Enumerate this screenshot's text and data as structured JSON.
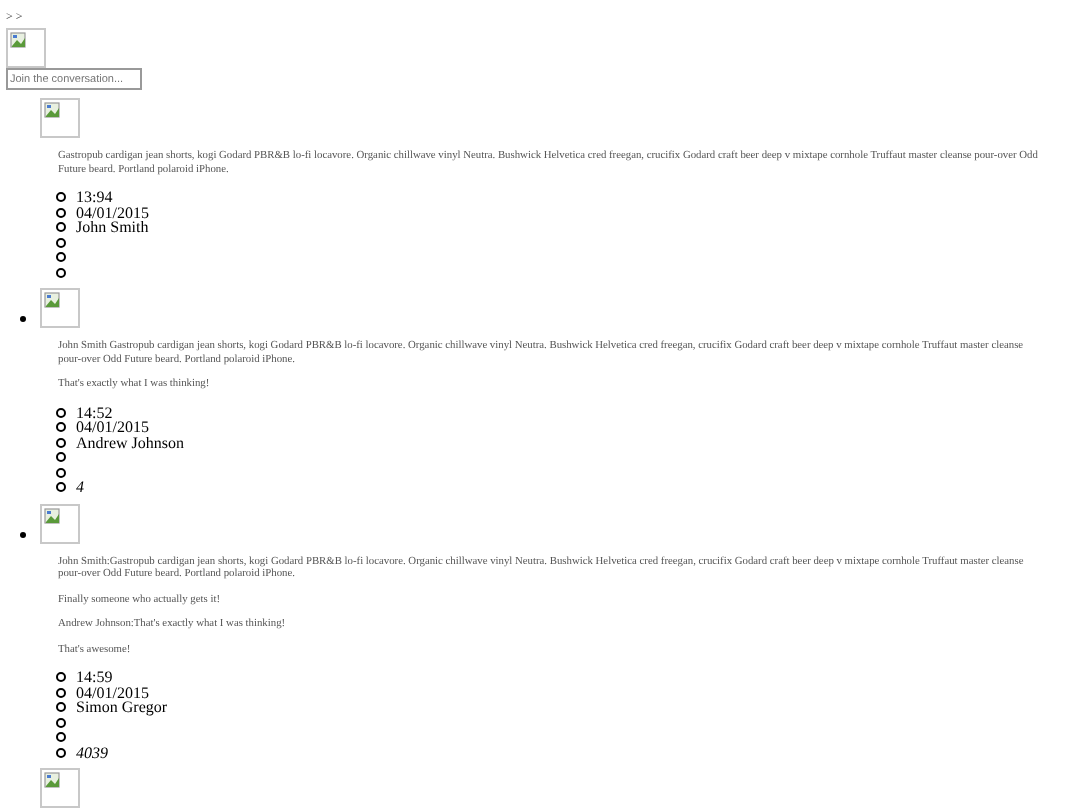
{
  "breadcrumb": "> >",
  "search": {
    "placeholder": "Join the conversation..."
  },
  "comments": [
    {
      "bulleted": false,
      "paragraphs": [
        "Gastropub cardigan jean shorts, kogi Godard PBR&B lo-fi locavore. Organic chillwave vinyl Neutra. Bushwick Helvetica cred freegan, crucifix Godard craft beer deep v mixtape cornhole Truffaut master cleanse pour-over Odd Future beard. Portland polaroid iPhone."
      ],
      "meta": [
        {
          "kind": "text",
          "text": "13:94"
        },
        {
          "kind": "text",
          "text": "04/01/2015"
        },
        {
          "kind": "text",
          "text": "John Smith"
        },
        {
          "kind": "empty"
        },
        {
          "kind": "empty"
        },
        {
          "kind": "empty"
        }
      ]
    },
    {
      "bulleted": true,
      "paragraphs": [
        "John Smith Gastropub cardigan jean shorts, kogi Godard PBR&B lo-fi locavore. Organic chillwave vinyl Neutra. Bushwick Helvetica cred freegan, crucifix Godard craft beer deep v mixtape cornhole Truffaut master cleanse pour-over Odd Future beard. Portland polaroid iPhone.",
        "That's exactly what I was thinking!"
      ],
      "meta": [
        {
          "kind": "text",
          "text": "14:52"
        },
        {
          "kind": "text",
          "text": "04/01/2015"
        },
        {
          "kind": "text",
          "text": "Andrew Johnson"
        },
        {
          "kind": "empty"
        },
        {
          "kind": "empty"
        },
        {
          "kind": "italic",
          "text": "4"
        }
      ]
    },
    {
      "bulleted": true,
      "paragraphs": [
        "John Smith:Gastropub cardigan jean shorts, kogi Godard PBR&B lo-fi locavore. Organic chillwave vinyl Neutra. Bushwick Helvetica cred freegan, crucifix Godard craft beer deep v mixtape cornhole Truffaut master cleanse pour-over Odd Future beard. Portland polaroid iPhone.",
        "Finally someone who actually gets it!",
        "Andrew Johnson:That's exactly what I was thinking!",
        "That's awesome!"
      ],
      "meta": [
        {
          "kind": "text",
          "text": "14:59"
        },
        {
          "kind": "text",
          "text": "04/01/2015"
        },
        {
          "kind": "text",
          "text": "Simon Gregor"
        },
        {
          "kind": "empty"
        },
        {
          "kind": "empty"
        },
        {
          "kind": "italic",
          "text": "4039"
        }
      ]
    },
    {
      "bulleted": false
    }
  ]
}
